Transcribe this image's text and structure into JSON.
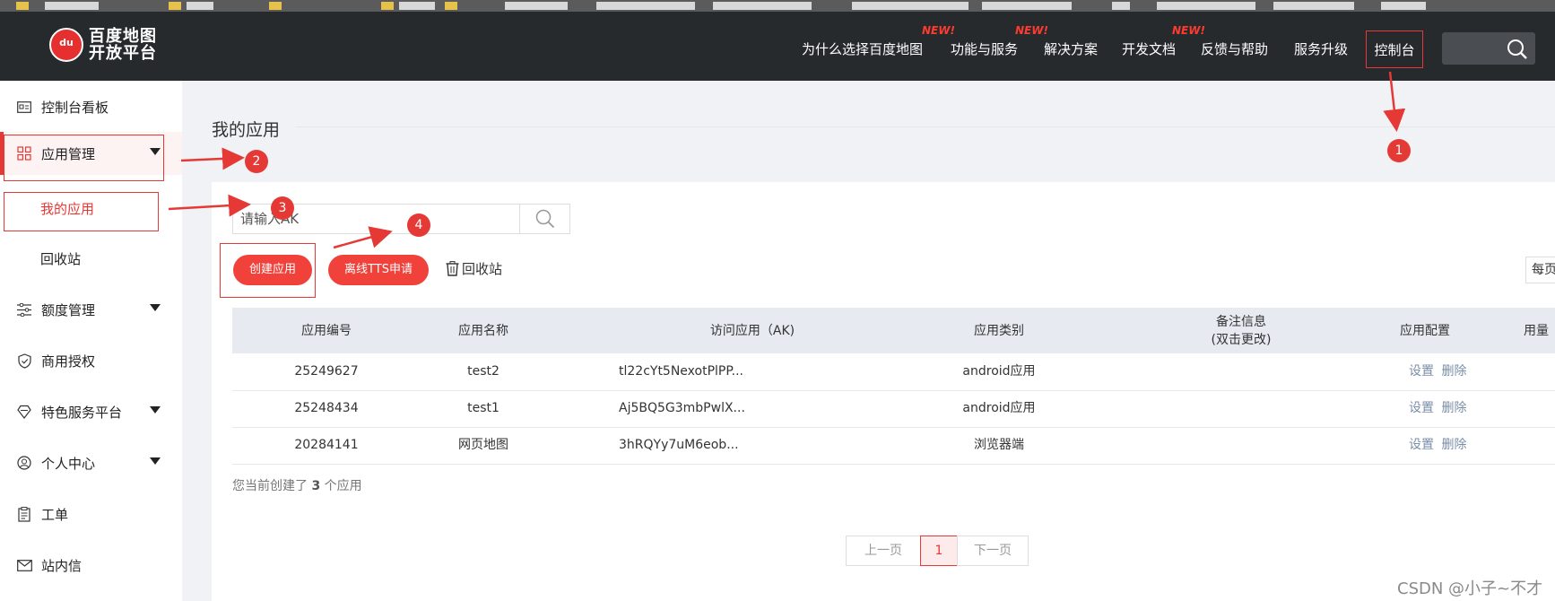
{
  "nav": {
    "logo_text_line1": "百度地图",
    "logo_text_line2": "开放平台",
    "logo_mark": "du",
    "items": [
      "为什么选择百度地图",
      "功能与服务",
      "解决方案",
      "开发文档",
      "反馈与帮助",
      "服务升级"
    ],
    "new_badge": "NEW!",
    "console": "控制台"
  },
  "sidebar": {
    "dashboard": "控制台看板",
    "app_manage": "应用管理",
    "my_apps": "我的应用",
    "recycle": "回收站",
    "quota": "额度管理",
    "commercial": "商用授权",
    "special": "特色服务平台",
    "personal": "个人中心",
    "ticket": "工单",
    "inbox": "站内信"
  },
  "main": {
    "title": "我的应用",
    "ak_placeholder": "请输入AK",
    "create_button": "创建应用",
    "tts_button": "离线TTS申请",
    "recycle_link": "回收站",
    "per_page": "每页"
  },
  "table": {
    "headers": {
      "id": "应用编号",
      "name": "应用名称",
      "ak": "访问应用（AK)",
      "type": "应用类别",
      "remark1": "备注信息",
      "remark2": "(双击更改)",
      "config": "应用配置",
      "usage": "用量"
    },
    "rows": [
      {
        "id": "25249627",
        "name": "test2",
        "ak": "tl22cYt5NexotPlPP...",
        "type": "android应用",
        "set": "设置",
        "del": "删除"
      },
      {
        "id": "25248434",
        "name": "test1",
        "ak": "Aj5BQ5G3mbPwlX...",
        "type": "android应用",
        "set": "设置",
        "del": "删除"
      },
      {
        "id": "20284141",
        "name": "网页地图",
        "ak": "3hRQYy7uM6eob...",
        "type": "浏览器端",
        "set": "设置",
        "del": "删除"
      }
    ]
  },
  "footer": {
    "prefix": "您当前创建了",
    "count": "3",
    "suffix": "个应用"
  },
  "pager": {
    "prev": "上一页",
    "current": "1",
    "next": "下一页"
  },
  "annotations": {
    "n1": "1",
    "n2": "2",
    "n3": "3",
    "n4": "4"
  },
  "watermark": "CSDN @小子~不才",
  "colors": {
    "accent": "#e53935",
    "nav_bg": "#262a2d",
    "button_red": "#f0413b"
  }
}
